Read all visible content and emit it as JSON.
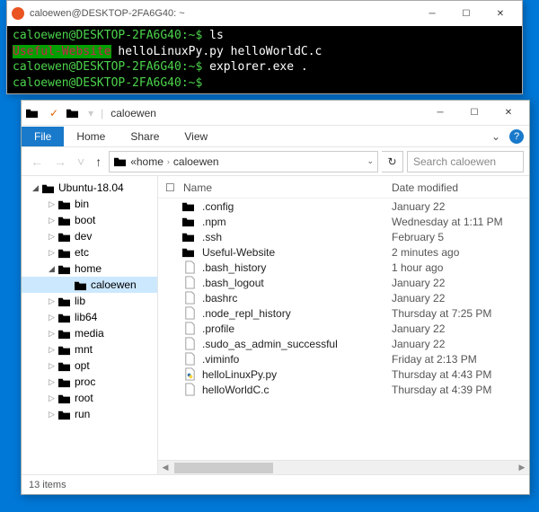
{
  "terminal": {
    "title": "caloewen@DESKTOP-2FA6G40: ~",
    "prompt": "caloewen@DESKTOP-2FA6G40",
    "path": "~",
    "lines": {
      "cmd1": "ls",
      "out_hl": "Useful-Website",
      "out_rest": "  helloLinuxPy.py  helloWorldC.c",
      "cmd2": "explorer.exe ."
    }
  },
  "explorer": {
    "title": "caloewen",
    "ribbon": {
      "file": "File",
      "home": "Home",
      "share": "Share",
      "view": "View"
    },
    "breadcrumb": {
      "p1": "«",
      "p2": "home",
      "p3": "caloewen"
    },
    "search_placeholder": "Search caloewen",
    "columns": {
      "name": "Name",
      "date": "Date modified"
    },
    "tree": {
      "root": "Ubuntu-18.04",
      "items": [
        "bin",
        "boot",
        "dev",
        "etc",
        "home",
        "lib",
        "lib64",
        "media",
        "mnt",
        "opt",
        "proc",
        "root",
        "run"
      ],
      "home_child": "caloewen"
    },
    "files": [
      {
        "name": ".config",
        "type": "folder",
        "date": "January 22"
      },
      {
        "name": ".npm",
        "type": "folder",
        "date": "Wednesday at 1:11 PM"
      },
      {
        "name": ".ssh",
        "type": "folder",
        "date": "February 5"
      },
      {
        "name": "Useful-Website",
        "type": "folder",
        "date": "2 minutes ago"
      },
      {
        "name": ".bash_history",
        "type": "file",
        "date": "1 hour ago"
      },
      {
        "name": ".bash_logout",
        "type": "file",
        "date": "January 22"
      },
      {
        "name": ".bashrc",
        "type": "file",
        "date": "January 22"
      },
      {
        "name": ".node_repl_history",
        "type": "file",
        "date": "Thursday at 7:25 PM"
      },
      {
        "name": ".profile",
        "type": "file",
        "date": "January 22"
      },
      {
        "name": ".sudo_as_admin_successful",
        "type": "file",
        "date": "January 22"
      },
      {
        "name": ".viminfo",
        "type": "file",
        "date": "Friday at 2:13 PM"
      },
      {
        "name": "helloLinuxPy.py",
        "type": "py",
        "date": "Thursday at 4:43 PM"
      },
      {
        "name": "helloWorldC.c",
        "type": "file",
        "date": "Thursday at 4:39 PM"
      }
    ],
    "status": "13 items"
  }
}
